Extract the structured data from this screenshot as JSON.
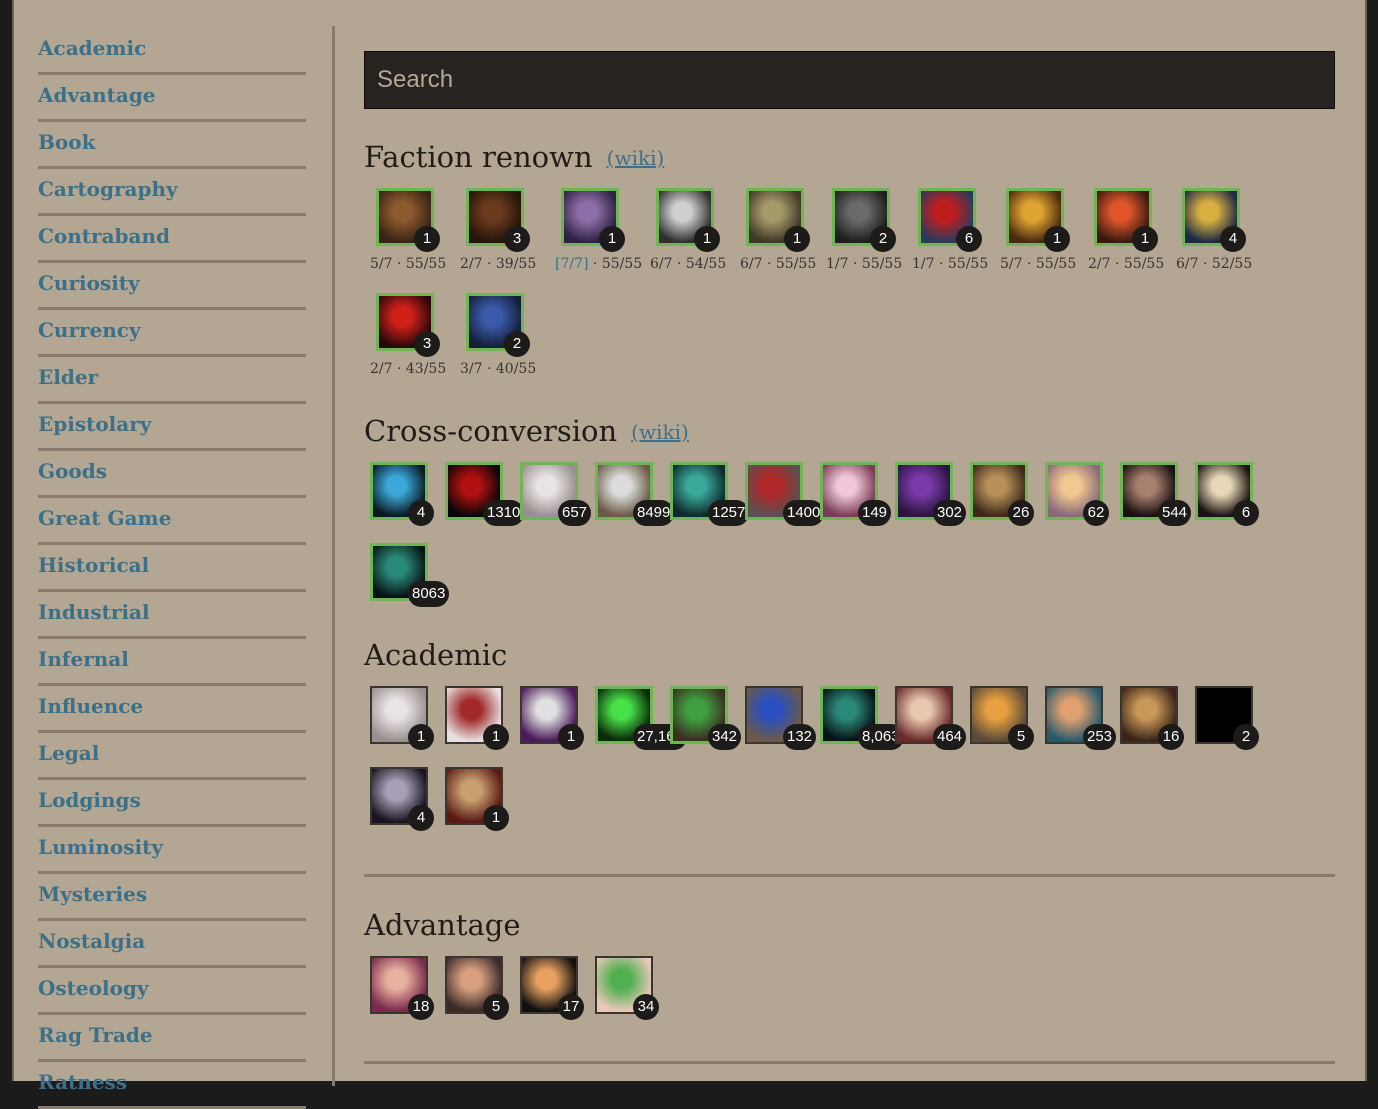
{
  "search": {
    "placeholder": "Search"
  },
  "sidebar": {
    "items": [
      {
        "label": "Academic"
      },
      {
        "label": "Advantage"
      },
      {
        "label": "Book"
      },
      {
        "label": "Cartography"
      },
      {
        "label": "Contraband"
      },
      {
        "label": "Curiosity"
      },
      {
        "label": "Currency"
      },
      {
        "label": "Elder"
      },
      {
        "label": "Epistolary"
      },
      {
        "label": "Goods"
      },
      {
        "label": "Great Game"
      },
      {
        "label": "Historical"
      },
      {
        "label": "Industrial"
      },
      {
        "label": "Infernal"
      },
      {
        "label": "Influence"
      },
      {
        "label": "Legal"
      },
      {
        "label": "Lodgings"
      },
      {
        "label": "Luminosity"
      },
      {
        "label": "Mysteries"
      },
      {
        "label": "Nostalgia"
      },
      {
        "label": "Osteology"
      },
      {
        "label": "Rag Trade"
      },
      {
        "label": "Ratness"
      }
    ]
  },
  "sections": [
    {
      "title": "Faction renown",
      "wiki": "(wiki)",
      "items": [
        {
          "name": "book",
          "count": "1",
          "sub_a": "5/7",
          "sub_b": " · 55/55",
          "owned": true,
          "colors": [
            "#8c5a2e",
            "#3a2314"
          ]
        },
        {
          "name": "door",
          "count": "3",
          "sub_a": "2/7",
          "sub_b": " · 39/55",
          "owned": true,
          "colors": [
            "#6b3a1c",
            "#24140a"
          ]
        },
        {
          "name": "bell-jar",
          "count": "1",
          "sub_a": "[7/7]",
          "sub_b": " · 55/55",
          "owned": true,
          "highlight": true,
          "colors": [
            "#8e6ea8",
            "#2e2244"
          ]
        },
        {
          "name": "tankard",
          "count": "1",
          "sub_a": "6/7",
          "sub_b": " · 54/55",
          "owned": true,
          "colors": [
            "#cfcfcf",
            "#2f2f2f"
          ]
        },
        {
          "name": "key",
          "count": "1",
          "sub_a": "6/7",
          "sub_b": " · 55/55",
          "owned": true,
          "colors": [
            "#a69a6a",
            "#3e3826"
          ]
        },
        {
          "name": "typewriter",
          "count": "2",
          "sub_a": "1/7",
          "sub_b": " · 55/55",
          "owned": true,
          "colors": [
            "#6a6a6a",
            "#1e1e1e"
          ]
        },
        {
          "name": "flag",
          "count": "6",
          "sub_a": "1/7",
          "sub_b": " · 55/55",
          "owned": true,
          "colors": [
            "#c01e1e",
            "#2c3a5a"
          ]
        },
        {
          "name": "lantern",
          "count": "1",
          "sub_a": "5/7",
          "sub_b": " · 55/55",
          "owned": true,
          "colors": [
            "#e0a432",
            "#4a2a0e"
          ]
        },
        {
          "name": "ring",
          "count": "1",
          "sub_a": "2/7",
          "sub_b": " · 55/55",
          "owned": true,
          "colors": [
            "#e0562a",
            "#3a1a10"
          ]
        },
        {
          "name": "skull",
          "count": "4",
          "sub_a": "6/7",
          "sub_b": " · 52/55",
          "owned": true,
          "colors": [
            "#d8b040",
            "#1e2a44"
          ]
        },
        {
          "name": "crystal",
          "count": "3",
          "sub_a": "2/7",
          "sub_b": " · 43/55",
          "owned": true,
          "colors": [
            "#d0201a",
            "#2a0808"
          ]
        },
        {
          "name": "blue-book",
          "count": "2",
          "sub_a": "3/7",
          "sub_b": " · 40/55",
          "owned": true,
          "colors": [
            "#3a5aa8",
            "#141e3a"
          ]
        }
      ]
    },
    {
      "title": "Cross-conversion",
      "wiki": "(wiki)",
      "items": [
        {
          "name": "blue-flask",
          "count": "4",
          "owned": true,
          "colors": [
            "#3aa8d8",
            "#0a1a24"
          ]
        },
        {
          "name": "red-eyes",
          "count": "1310",
          "owned": true,
          "colors": [
            "#b01010",
            "#0a0606"
          ]
        },
        {
          "name": "letter",
          "count": "657",
          "owned": true,
          "colors": [
            "#e8e4e4",
            "#9a9090"
          ]
        },
        {
          "name": "mirror",
          "count": "8499",
          "owned": true,
          "colors": [
            "#dcdcdc",
            "#6a5a48"
          ]
        },
        {
          "name": "storm-sea",
          "count": "1257",
          "owned": true,
          "colors": [
            "#3aa89a",
            "#0e2a2a"
          ]
        },
        {
          "name": "bottle",
          "count": "1400",
          "owned": true,
          "colors": [
            "#b02828",
            "#5a5050"
          ]
        },
        {
          "name": "tent",
          "count": "149",
          "owned": true,
          "colors": [
            "#f0c8d8",
            "#7a3c58"
          ]
        },
        {
          "name": "purple-book",
          "count": "302",
          "owned": true,
          "colors": [
            "#7a3aa8",
            "#2a1440"
          ]
        },
        {
          "name": "glyph",
          "count": "26",
          "owned": true,
          "colors": [
            "#b8905a",
            "#3a2a18"
          ]
        },
        {
          "name": "sunset",
          "count": "62",
          "owned": true,
          "colors": [
            "#f0c890",
            "#8a6a78"
          ]
        },
        {
          "name": "mountain",
          "count": "544",
          "owned": true,
          "colors": [
            "#a88070",
            "#1a1010"
          ]
        },
        {
          "name": "silhouettes",
          "count": "6",
          "owned": true,
          "colors": [
            "#e8d8b8",
            "#1a1410"
          ]
        },
        {
          "name": "dark-sea",
          "count": "8063",
          "owned": true,
          "colors": [
            "#2a8a7a",
            "#081414"
          ]
        }
      ]
    },
    {
      "title": "Academic",
      "wiki": "",
      "items": [
        {
          "name": "letter",
          "count": "1",
          "owned": false,
          "colors": [
            "#e8e4e4",
            "#9a9090"
          ]
        },
        {
          "name": "red-papers",
          "count": "1",
          "owned": false,
          "colors": [
            "#a02a2a",
            "#e8e0e0"
          ]
        },
        {
          "name": "geode",
          "count": "1",
          "owned": false,
          "colors": [
            "#e0e0e0",
            "#4a1a5a"
          ]
        },
        {
          "name": "green-candle",
          "count": "27,169",
          "owned": true,
          "colors": [
            "#48e048",
            "#0a2a0a"
          ]
        },
        {
          "name": "green-bottle",
          "count": "342",
          "owned": true,
          "colors": [
            "#40a040",
            "#3a3020"
          ]
        },
        {
          "name": "blue-bottle",
          "count": "132",
          "owned": false,
          "colors": [
            "#2a50c0",
            "#6a5a48"
          ]
        },
        {
          "name": "dark-sea",
          "count": "8,063",
          "owned": true,
          "colors": [
            "#2a8a7a",
            "#081414"
          ]
        },
        {
          "name": "scholar",
          "count": "464",
          "owned": false,
          "colors": [
            "#e8c8b0",
            "#6a2a2a"
          ]
        },
        {
          "name": "orange-flask",
          "count": "5",
          "owned": false,
          "colors": [
            "#e8a040",
            "#5a4a38"
          ]
        },
        {
          "name": "mask",
          "count": "253",
          "owned": false,
          "colors": [
            "#e0a070",
            "#2a5a6a"
          ]
        },
        {
          "name": "books",
          "count": "16",
          "owned": false,
          "colors": [
            "#c89858",
            "#3a2418"
          ]
        },
        {
          "name": "void",
          "count": "2",
          "owned": false,
          "colors": [
            "#000000",
            "#000000"
          ]
        },
        {
          "name": "skull-flask",
          "count": "4",
          "owned": false,
          "colors": [
            "#a8a0b8",
            "#1a1420"
          ]
        },
        {
          "name": "sigil",
          "count": "1",
          "owned": false,
          "colors": [
            "#c8a070",
            "#5a1a14"
          ]
        }
      ]
    },
    {
      "title": "Advantage",
      "wiki": "",
      "items": [
        {
          "name": "smile",
          "count": "18",
          "owned": false,
          "colors": [
            "#e8b0a0",
            "#7a2a4a"
          ]
        },
        {
          "name": "fist",
          "count": "5",
          "owned": false,
          "colors": [
            "#d8a080",
            "#3a2a28"
          ]
        },
        {
          "name": "glove",
          "count": "17",
          "owned": false,
          "colors": [
            "#e8a060",
            "#101010"
          ]
        },
        {
          "name": "eye",
          "count": "34",
          "owned": false,
          "colors": [
            "#50b050",
            "#e8c8b8"
          ]
        }
      ]
    }
  ]
}
